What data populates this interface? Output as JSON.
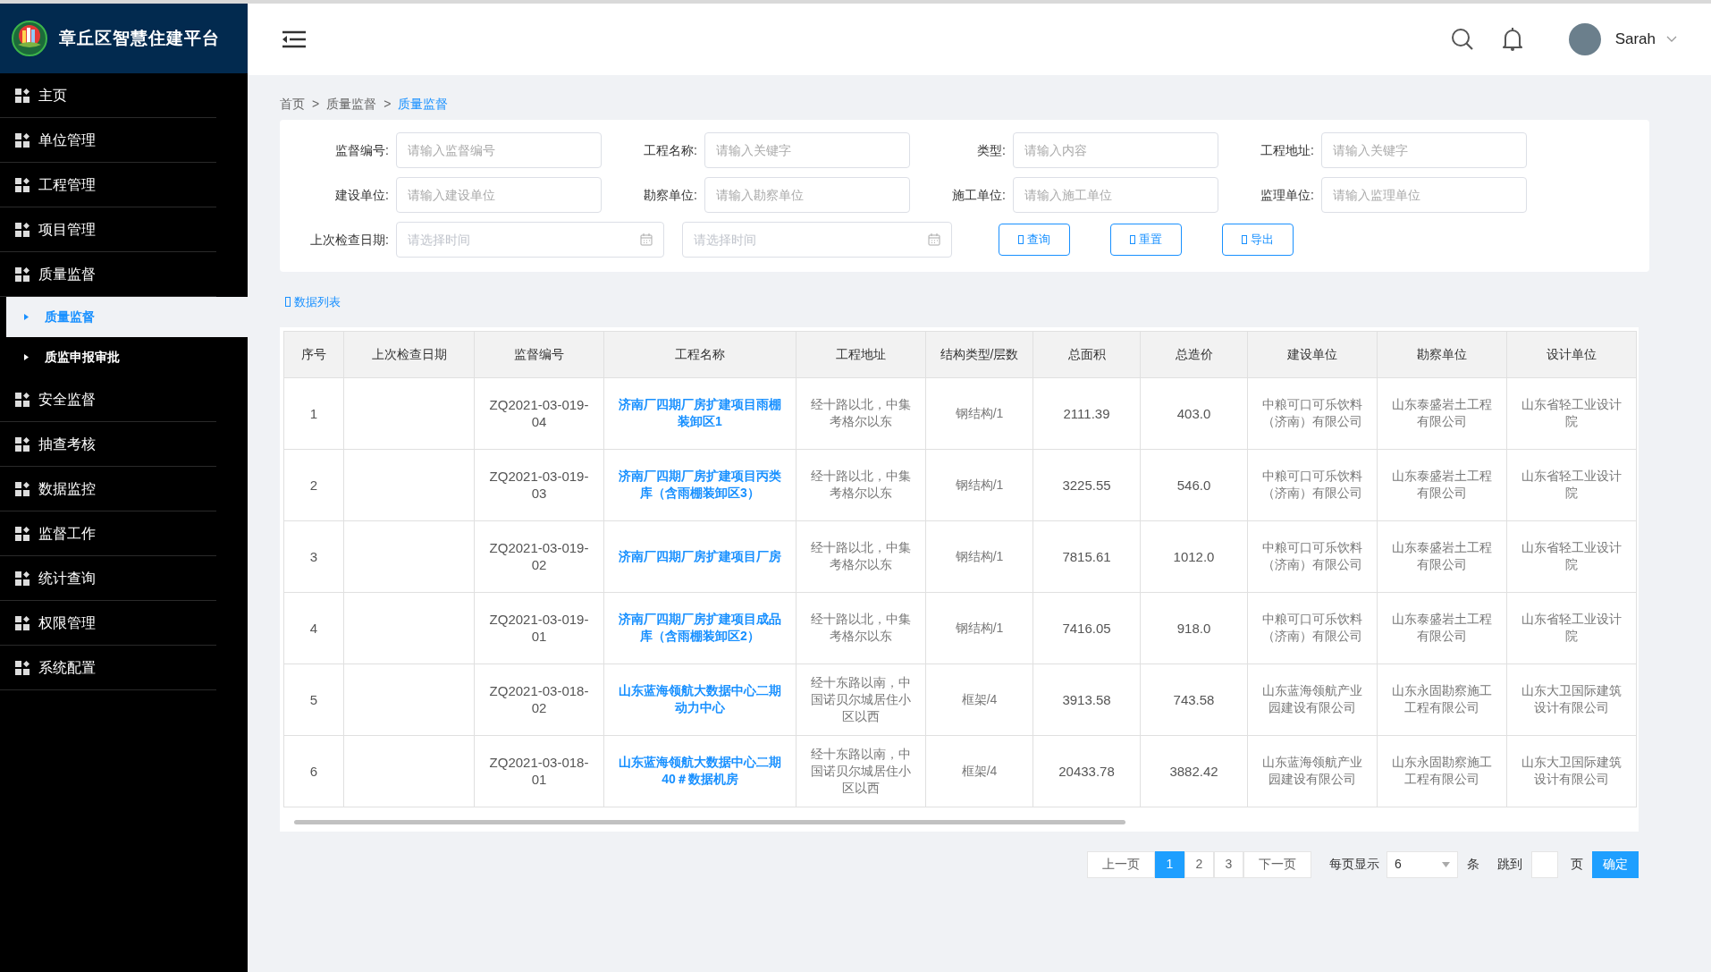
{
  "app": {
    "title": "章丘区智慧住建平台"
  },
  "sidebar": {
    "items": [
      {
        "label": "主页"
      },
      {
        "label": "单位管理"
      },
      {
        "label": "工程管理"
      },
      {
        "label": "项目管理"
      },
      {
        "label": "质量监督",
        "children": [
          {
            "label": "质量监督",
            "selected": true
          },
          {
            "label": "质监申报审批",
            "selected": false
          }
        ]
      },
      {
        "label": "安全监督"
      },
      {
        "label": "抽查考核"
      },
      {
        "label": "数据监控"
      },
      {
        "label": "监督工作"
      },
      {
        "label": "统计查询"
      },
      {
        "label": "权限管理"
      },
      {
        "label": "系统配置"
      }
    ]
  },
  "header": {
    "user": "Sarah"
  },
  "breadcrumb": [
    {
      "label": "首页",
      "current": false
    },
    {
      "separator": ">",
      "label": "质量监督",
      "current": false
    },
    {
      "separator": ">",
      "label": "质量监督",
      "current": true
    }
  ],
  "filters": [
    {
      "label": "监督编号:",
      "placeholder": "请输入监督编号"
    },
    {
      "label": "工程名称:",
      "placeholder": "请输入关键字"
    },
    {
      "label": "类型:",
      "placeholder": "请输入内容"
    },
    {
      "label": "工程地址:",
      "placeholder": "请输入关键字"
    },
    {
      "label": "建设单位:",
      "placeholder": "请输入建设单位"
    },
    {
      "label": "勘察单位:",
      "placeholder": "请输入勘察单位"
    },
    {
      "label": "施工单位:",
      "placeholder": "请输入施工单位"
    },
    {
      "label": "监理单位:",
      "placeholder": "请输入监理单位"
    }
  ],
  "date_filter": {
    "label": "上次检查日期:",
    "start_placeholder": "请选择时间",
    "end_placeholder": "请选择时间"
  },
  "buttons": [
    "查询",
    "重置",
    "导出"
  ],
  "list_title": "数据列表",
  "table": {
    "columns": [
      "序号",
      "上次检查日期",
      "监督编号",
      "工程名称",
      "工程地址",
      "结构类型/层数",
      "总面积",
      "总造价",
      "建设单位",
      "勘察单位",
      "设计单位"
    ],
    "rows": [
      {
        "index": "1",
        "code": "ZQ2021-03-019-04",
        "name": "济南厂四期厂房扩建项目雨棚装卸区1",
        "address": "经十路以北，中集考格尔以东",
        "structure": "钢结构/1",
        "area": "2111.39",
        "cost": "403.0",
        "builder": "中粮可口可乐饮料（济南）有限公司",
        "surveyor": "山东泰盛岩土工程有限公司",
        "designer": "山东省轻工业设计院"
      },
      {
        "index": "2",
        "code": "ZQ2021-03-019-03",
        "name": "济南厂四期厂房扩建项目丙类库（含雨棚装卸区3）",
        "address": "经十路以北，中集考格尔以东",
        "structure": "钢结构/1",
        "area": "3225.55",
        "cost": "546.0",
        "builder": "中粮可口可乐饮料（济南）有限公司",
        "surveyor": "山东泰盛岩土工程有限公司",
        "designer": "山东省轻工业设计院"
      },
      {
        "index": "3",
        "code": "ZQ2021-03-019-02",
        "name": "济南厂四期厂房扩建项目厂房",
        "address": "经十路以北，中集考格尔以东",
        "structure": "钢结构/1",
        "area": "7815.61",
        "cost": "1012.0",
        "builder": "中粮可口可乐饮料（济南）有限公司",
        "surveyor": "山东泰盛岩土工程有限公司",
        "designer": "山东省轻工业设计院"
      },
      {
        "index": "4",
        "code": "ZQ2021-03-019-01",
        "name": "济南厂四期厂房扩建项目成品库（含雨棚装卸区2）",
        "address": "经十路以北，中集考格尔以东",
        "structure": "钢结构/1",
        "area": "7416.05",
        "cost": "918.0",
        "builder": "中粮可口可乐饮料（济南）有限公司",
        "surveyor": "山东泰盛岩土工程有限公司",
        "designer": "山东省轻工业设计院"
      },
      {
        "index": "5",
        "code": "ZQ2021-03-018-02",
        "name": "山东蓝海领航大数据中心二期动力中心",
        "address": "经十东路以南，中国诺贝尔城居住小区以西",
        "structure": "框架/4",
        "area": "3913.58",
        "cost": "743.58",
        "builder": "山东蓝海领航产业园建设有限公司",
        "surveyor": "山东永固勘察施工工程有限公司",
        "designer": "山东大卫国际建筑设计有限公司"
      },
      {
        "index": "6",
        "code": "ZQ2021-03-018-01",
        "name": "山东蓝海领航大数据中心二期40＃数据机房",
        "address": "经十东路以南，中国诺贝尔城居住小区以西",
        "structure": "框架/4",
        "area": "20433.78",
        "cost": "3882.42",
        "builder": "山东蓝海领航产业园建设有限公司",
        "surveyor": "山东永固勘察施工工程有限公司",
        "designer": "山东大卫国际建筑设计有限公司"
      }
    ]
  },
  "pagination": {
    "prev": "上一页",
    "pages": [
      {
        "label": "1",
        "selected": true
      },
      {
        "label": "2",
        "selected": false
      },
      {
        "label": "3",
        "selected": false
      }
    ],
    "next": "下一页",
    "per_page_label": "每页显示",
    "per_page": "6",
    "unit": "条",
    "jump_label": "跳到",
    "page_unit": "页",
    "confirm": "确定"
  }
}
